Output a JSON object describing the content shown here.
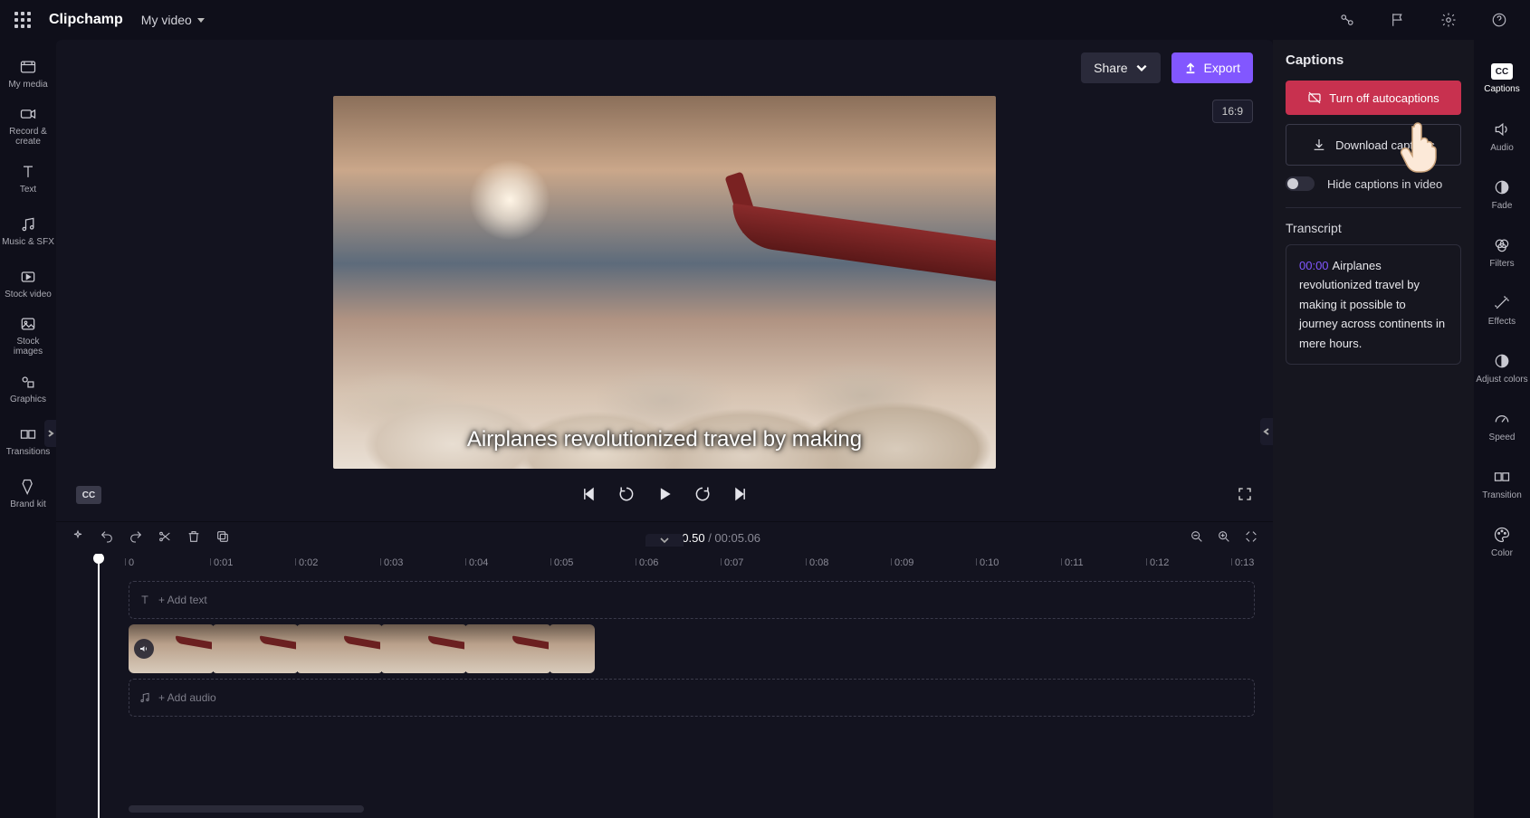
{
  "topbar": {
    "brand": "Clipchamp",
    "project": "My video"
  },
  "sidebar_left": {
    "items": [
      {
        "label": "My media"
      },
      {
        "label": "Record & create"
      },
      {
        "label": "Text"
      },
      {
        "label": "Music & SFX"
      },
      {
        "label": "Stock video"
      },
      {
        "label": "Stock images"
      },
      {
        "label": "Graphics"
      },
      {
        "label": "Transitions"
      },
      {
        "label": "Brand kit"
      }
    ]
  },
  "header_buttons": {
    "share": "Share",
    "export": "Export"
  },
  "preview": {
    "aspect": "16:9",
    "caption": "Airplanes revolutionized travel by making",
    "cc_badge": "CC"
  },
  "timecode": {
    "current": "00:00.50",
    "total": "00:05.06"
  },
  "ruler": [
    "0",
    "0:01",
    "0:02",
    "0:03",
    "0:04",
    "0:05",
    "0:06",
    "0:07",
    "0:08",
    "0:09",
    "0:10",
    "0:11",
    "0:12",
    "0:13"
  ],
  "tracks": {
    "text_placeholder": "+ Add text",
    "audio_placeholder": "+ Add audio"
  },
  "captions_panel": {
    "title": "Captions",
    "turn_off": "Turn off autocaptions",
    "download": "Download captions",
    "hide": "Hide captions in video",
    "transcript_label": "Transcript",
    "transcript": {
      "ts": "00:00",
      "text": "Airplanes revolutionized travel by making it possible to journey across continents in mere hours."
    }
  },
  "sidebar_right": {
    "items": [
      {
        "label": "Captions"
      },
      {
        "label": "Audio"
      },
      {
        "label": "Fade"
      },
      {
        "label": "Filters"
      },
      {
        "label": "Effects"
      },
      {
        "label": "Adjust colors"
      },
      {
        "label": "Speed"
      },
      {
        "label": "Transition"
      },
      {
        "label": "Color"
      }
    ]
  }
}
